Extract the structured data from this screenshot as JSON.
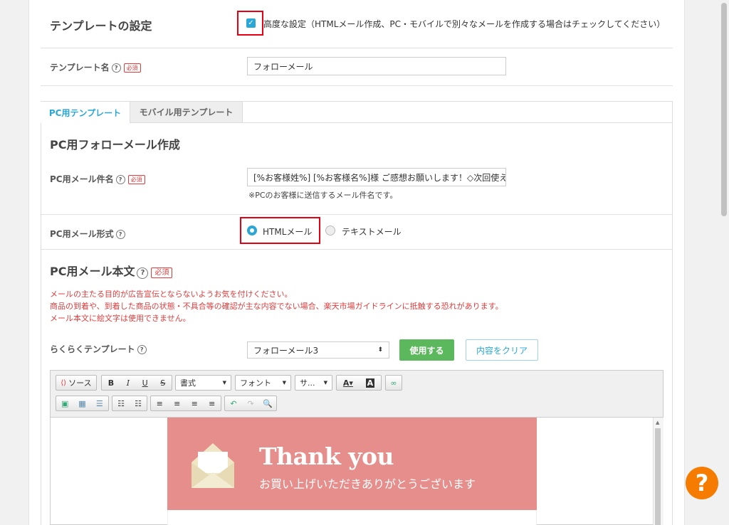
{
  "template_settings": {
    "title": "テンプレートの設定",
    "advanced_label": "高度な設定（HTMLメール作成、PC・モバイルで別々なメールを作成する場合はチェックしてください）"
  },
  "template_name": {
    "label": "テンプレート名",
    "required": "必須",
    "value": "フォローメール"
  },
  "tabs": {
    "pc": "PC用テンプレート",
    "mobile": "モバイル用テンプレート"
  },
  "pc_section_title": "PC用フォローメール作成",
  "subject": {
    "label": "PC用メール件名",
    "required": "必須",
    "value": "[%お客様姓%] [%お客様名%]様 ご感想お願いします！◇次回使え",
    "note": "※PCのお客様に送信するメール件名です。"
  },
  "format": {
    "label": "PC用メール形式",
    "html": "HTMLメール",
    "text": "テキストメール"
  },
  "body": {
    "title": "PC用メール本文",
    "required": "必須",
    "warnings": [
      "メールの主たる目的が広告宣伝とならないようお気を付けください。",
      "商品の到着や、到着した商品の状態・不具合等の確認が主な内容でない場合、楽天市場ガイドラインに抵触する恐れがあります。",
      "メール本文に絵文字は使用できません。"
    ]
  },
  "easy_template": {
    "label": "らくらくテンプレート",
    "selected": "フォローメール3",
    "use_button": "使用する",
    "clear_button": "内容をクリア"
  },
  "toolbar": {
    "source": "ソース",
    "bold": "B",
    "italic": "I",
    "underline": "U",
    "strike": "S",
    "format": "書式",
    "font": "フォント",
    "size": "サ..."
  },
  "banner": {
    "title": "Thank you",
    "subtitle": "お買い上げいただきありがとうございます"
  },
  "colors": {
    "accent": "#2aa7d6",
    "banner": "#e58e8b",
    "use_btn": "#5cb85c",
    "warning": "#e03c3c",
    "highlight": "#e60012"
  }
}
